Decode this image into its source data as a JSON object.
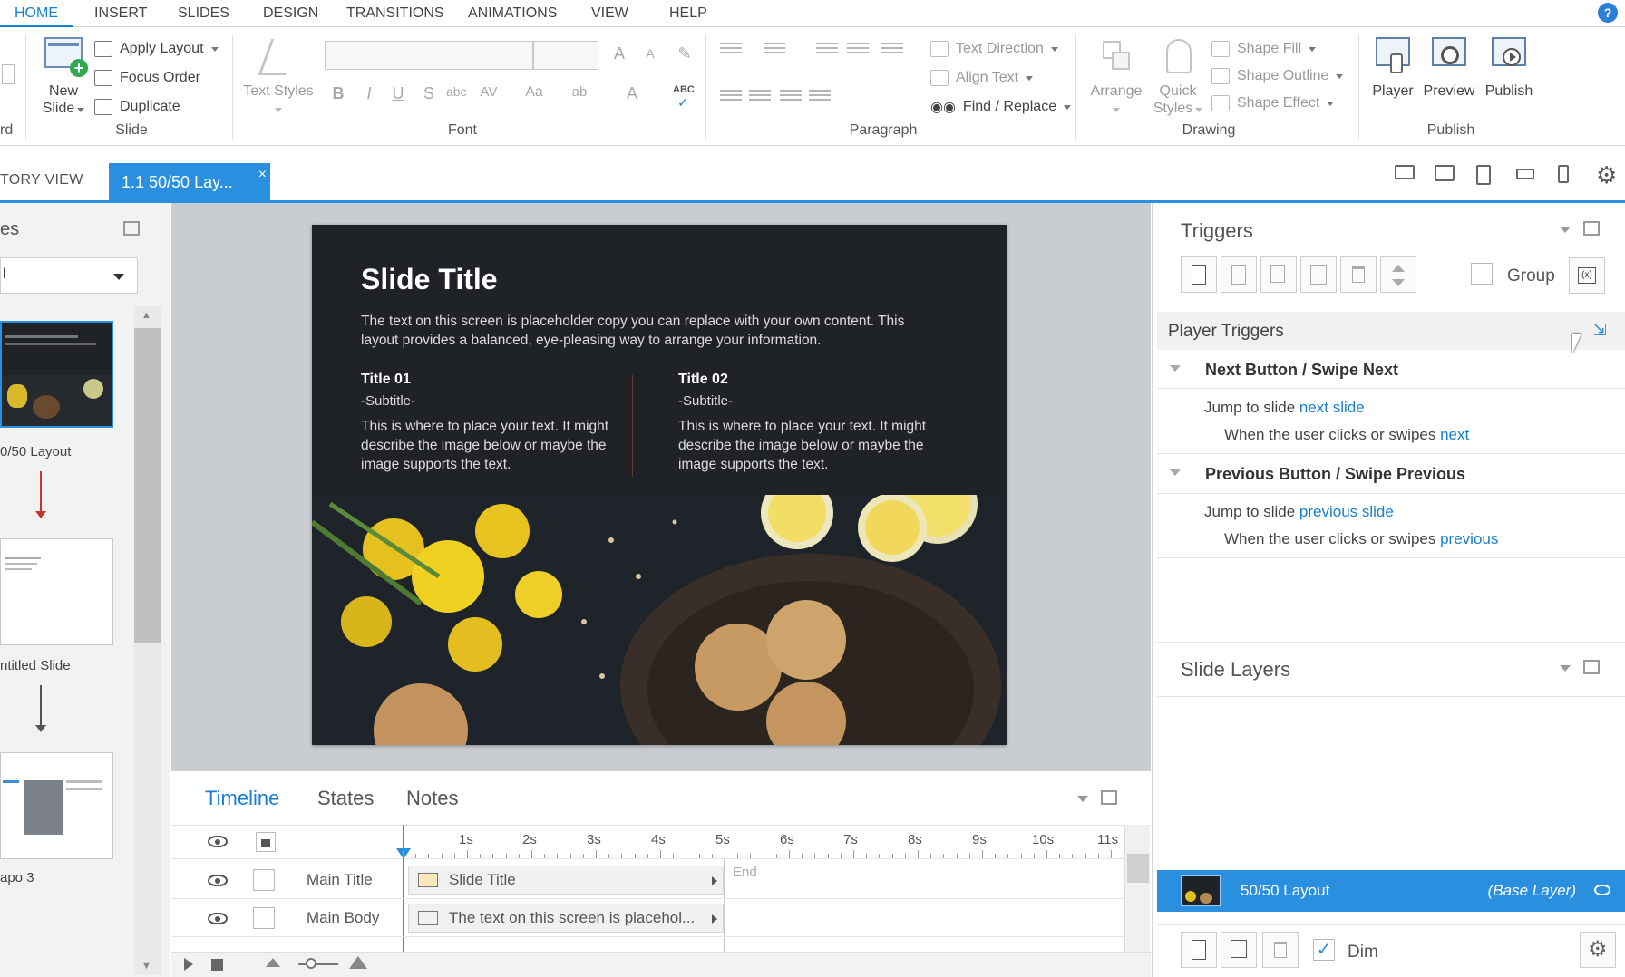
{
  "menu": {
    "tabs": [
      "HOME",
      "INSERT",
      "SLIDES",
      "DESIGN",
      "TRANSITIONS",
      "ANIMATIONS",
      "VIEW",
      "HELP"
    ],
    "active": "HOME"
  },
  "ribbon": {
    "clipboard_partial_label": "rd",
    "slide_group": {
      "new_slide_line1": "New",
      "new_slide_line2": "Slide",
      "apply_layout": "Apply Layout",
      "focus_order": "Focus Order",
      "duplicate": "Duplicate",
      "label": "Slide"
    },
    "text_styles": "Text Styles",
    "font_group_label": "Font",
    "paragraph": {
      "text_direction": "Text Direction",
      "align_text": "Align Text",
      "find_replace": "Find / Replace",
      "label": "Paragraph"
    },
    "drawing": {
      "arrange": "Arrange",
      "quick_styles_line1": "Quick",
      "quick_styles_line2": "Styles",
      "shape_fill": "Shape Fill",
      "shape_outline": "Shape Outline",
      "shape_effect": "Shape Effect",
      "label": "Drawing"
    },
    "publish": {
      "player": "Player",
      "preview": "Preview",
      "publish": "Publish",
      "label": "Publish"
    }
  },
  "doc_tabs": {
    "story_view": "TORY VIEW",
    "active_tab": "1.1 50/50 Lay..."
  },
  "left_panel": {
    "title_partial": "es",
    "dropdown_value": "l",
    "slides": [
      {
        "label": "0/50 Layout"
      },
      {
        "label": "ntitled Slide"
      },
      {
        "label": "apo 3"
      }
    ]
  },
  "slide": {
    "title": "Slide Title",
    "intro": "The text on this screen is placeholder copy you can replace with your own content. This layout provides a balanced, eye-pleasing way to arrange your information.",
    "col1": {
      "title": "Title 01",
      "subtitle": "-Subtitle-",
      "body": "This is where to place your text. It might describe the image below or maybe the image supports the text."
    },
    "col2": {
      "title": "Title 02",
      "subtitle": "-Subtitle-",
      "body": "This is where to place your text. It might describe the image below or maybe the image supports the text."
    }
  },
  "timeline": {
    "tabs": [
      "Timeline",
      "States",
      "Notes"
    ],
    "active_tab": "Timeline",
    "ruler": [
      "1s",
      "2s",
      "3s",
      "4s",
      "5s",
      "6s",
      "7s",
      "8s",
      "9s",
      "10s",
      "11s"
    ],
    "end_label": "End",
    "rows": [
      {
        "name": "Main Title",
        "bar": "Slide Title"
      },
      {
        "name": "Main Body",
        "bar": "The text on this screen is placehol..."
      }
    ]
  },
  "triggers": {
    "title": "Triggers",
    "group_label": "Group",
    "player_triggers_label": "Player Triggers",
    "items": [
      {
        "title": "Next Button / Swipe Next",
        "action_prefix": "Jump to slide ",
        "action_link": "next slide",
        "cond_prefix": "When the user clicks or swipes ",
        "cond_link": "next"
      },
      {
        "title": "Previous Button / Swipe Previous",
        "action_prefix": "Jump to slide ",
        "action_link": "previous slide",
        "cond_prefix": "When the user clicks or swipes ",
        "cond_link": "previous"
      }
    ]
  },
  "layers": {
    "title": "Slide Layers",
    "base": {
      "name": "50/50 Layout",
      "tag": "(Base Layer)"
    },
    "dim_label": "Dim",
    "dim_checked": true
  },
  "colors": {
    "accent": "#2b8fe0",
    "link": "#1a7fd0",
    "slide_bg": "#1f2226"
  }
}
